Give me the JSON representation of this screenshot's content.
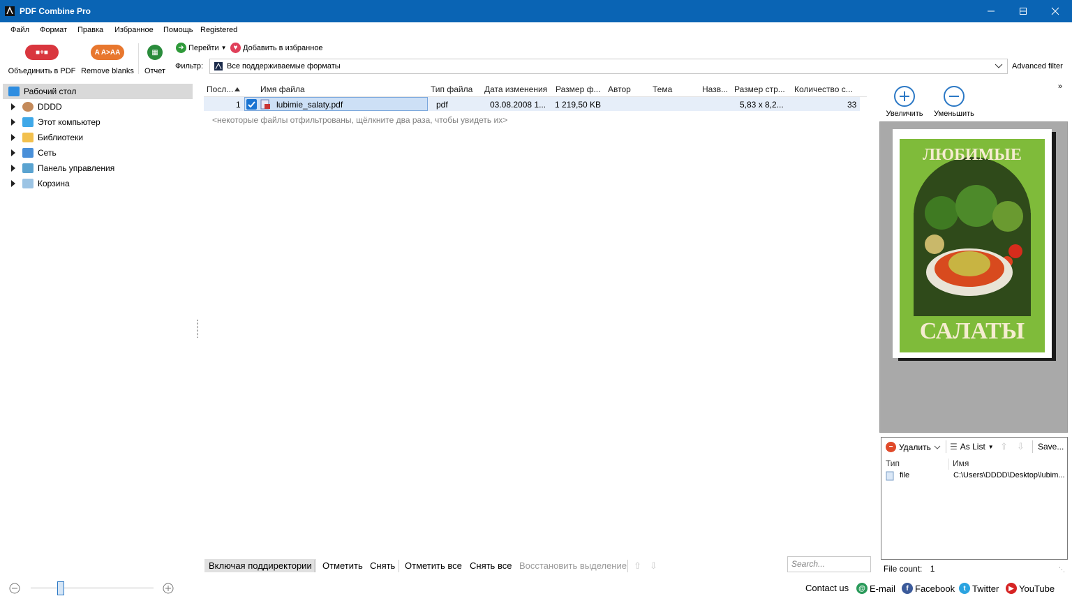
{
  "window": {
    "title": "PDF Combine Pro"
  },
  "menu": [
    "Файл",
    "Формат",
    "Правка",
    "Избранное",
    "Помощь",
    "Registered"
  ],
  "toolbar": {
    "combine_label": "Объединить в PDF",
    "remove_blanks_label": "Remove blanks",
    "report_label": "Отчет",
    "goto_label": "Перейти",
    "add_favorite_label": "Добавить в избранное",
    "filter_label": "Фильтр:",
    "filter_value": "Все поддерживаемые форматы",
    "advanced_filter_label": "Advanced filter"
  },
  "tree": {
    "items": [
      {
        "label": "Рабочий стол",
        "icon": "desktop-icon",
        "selected": true
      },
      {
        "label": "DDDD",
        "icon": "user-icon"
      },
      {
        "label": "Этот компьютер",
        "icon": "computer-icon"
      },
      {
        "label": "Библиотеки",
        "icon": "libraries-icon"
      },
      {
        "label": "Сеть",
        "icon": "network-icon"
      },
      {
        "label": "Панель управления",
        "icon": "control-panel-icon"
      },
      {
        "label": "Корзина",
        "icon": "recycle-bin-icon"
      }
    ]
  },
  "grid": {
    "columns": [
      "Посл...",
      "Имя файла",
      "Тип файла",
      "Дата изменения",
      "Размер ф...",
      "Автор",
      "Тема",
      "Назв...",
      "Размер стр...",
      "Количество с..."
    ],
    "rows": [
      {
        "num": "1",
        "name": "lubimie_salaty.pdf",
        "type": "pdf",
        "date": "03.08.2008 1...",
        "size": "1 219,50 KB",
        "author": "",
        "subject": "",
        "title": "",
        "page_size": "5,83 x 8,2...",
        "pages": "33",
        "checked": true
      }
    ],
    "filtered_hint": "<некоторые файлы отфильтрованы, щёлкните два раза, чтобы увидеть их>"
  },
  "bottom_bar": {
    "include_subdirs": "Включая поддиректории",
    "check": "Отметить",
    "uncheck": "Снять",
    "check_all": "Отметить все",
    "uncheck_all": "Снять все",
    "restore_selection": "Восстановить выделение",
    "search_placeholder": "Search..."
  },
  "preview": {
    "zoom_in_label": "Увеличить",
    "zoom_out_label": "Уменьшить",
    "cover_title_top": "ЛЮБИМЫЕ",
    "cover_title_bottom": "САЛАТЫ"
  },
  "list_panel": {
    "delete_label": "Удалить",
    "view_label": "As List",
    "save_label": "Save...",
    "col_type": "Тип",
    "col_name": "Имя",
    "row_type": "file",
    "row_name": "C:\\Users\\DDDD\\Desktop\\lubim..."
  },
  "file_count": {
    "label": "File count:",
    "value": "1"
  },
  "status": {
    "contact": "Contact us",
    "email": "E-mail",
    "facebook": "Facebook",
    "twitter": "Twitter",
    "youtube": "YouTube"
  },
  "colors": {
    "titlebar": "#0a64b4",
    "selection": "#e6eef9",
    "accent": "#2b78c5"
  }
}
